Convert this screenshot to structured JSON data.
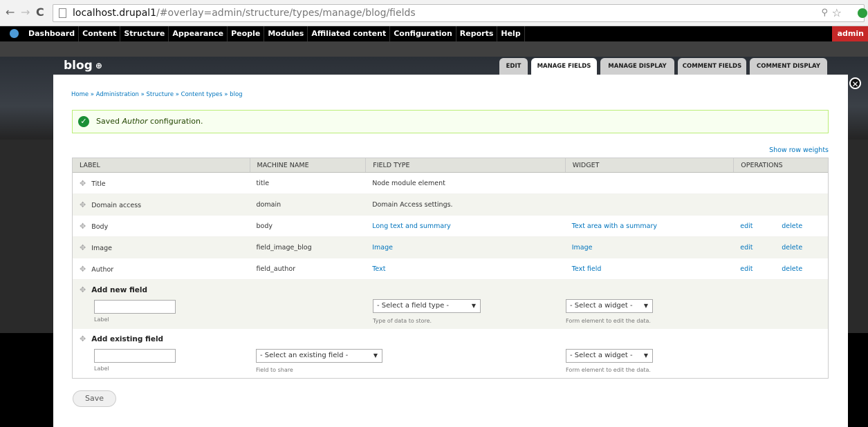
{
  "browser": {
    "url_host": "localhost.drupal1",
    "url_rest": "/#overlay=admin/structure/types/manage/blog/fields"
  },
  "toolbar": {
    "items": [
      "Dashboard",
      "Content",
      "Structure",
      "Appearance",
      "People",
      "Modules",
      "Affiliated content",
      "Configuration",
      "Reports",
      "Help"
    ],
    "user": "admin"
  },
  "overlay": {
    "title": "blog",
    "shortcut_symbol": "⊕",
    "tabs": [
      "EDIT",
      "MANAGE FIELDS",
      "MANAGE DISPLAY",
      "COMMENT FIELDS",
      "COMMENT DISPLAY"
    ],
    "active_tab": "MANAGE FIELDS"
  },
  "breadcrumb": "Home » Administration » Structure » Content types » blog",
  "message": {
    "before": "Saved ",
    "emphasis": "Author",
    "after": " configuration."
  },
  "row_weights_link": "Show row weights",
  "table": {
    "headers": [
      "LABEL",
      "MACHINE NAME",
      "FIELD TYPE",
      "WIDGET",
      "OPERATIONS"
    ],
    "rows": [
      {
        "label": "Title",
        "machine": "title",
        "type": "Node module element",
        "widget": "",
        "edit": "",
        "delete": ""
      },
      {
        "label": "Domain access",
        "machine": "domain",
        "type": "Domain Access settings.",
        "widget": "",
        "edit": "",
        "delete": ""
      },
      {
        "label": "Body",
        "machine": "body",
        "type": "Long text and summary",
        "widget": "Text area with a summary",
        "edit": "edit",
        "delete": "delete"
      },
      {
        "label": "Image",
        "machine": "field_image_blog",
        "type": "Image",
        "widget": "Image",
        "edit": "edit",
        "delete": "delete"
      },
      {
        "label": "Author",
        "machine": "field_author",
        "type": "Text",
        "widget": "Text field",
        "edit": "edit",
        "delete": "delete"
      }
    ]
  },
  "add_new": {
    "heading": "Add new field",
    "label_value": "",
    "label_caption": "Label",
    "field_type_select": "- Select a field type -",
    "field_type_caption": "Type of data to store.",
    "widget_select": "- Select a widget -",
    "widget_caption": "Form element to edit the data."
  },
  "add_existing": {
    "heading": "Add existing field",
    "label_value": "",
    "label_caption": "Label",
    "existing_select": "- Select an existing field -",
    "existing_caption": "Field to share",
    "widget_select": "- Select a widget -",
    "widget_caption": "Form element to edit the data."
  },
  "save_label": "Save",
  "icons": {
    "close": "✕",
    "check": "✓",
    "drag": "✥",
    "caret": "▼"
  },
  "colors": {
    "link": "#0074bd",
    "toolbar_bg": "#000000",
    "user_badge": "#c62828",
    "success": "#1b8f36"
  }
}
